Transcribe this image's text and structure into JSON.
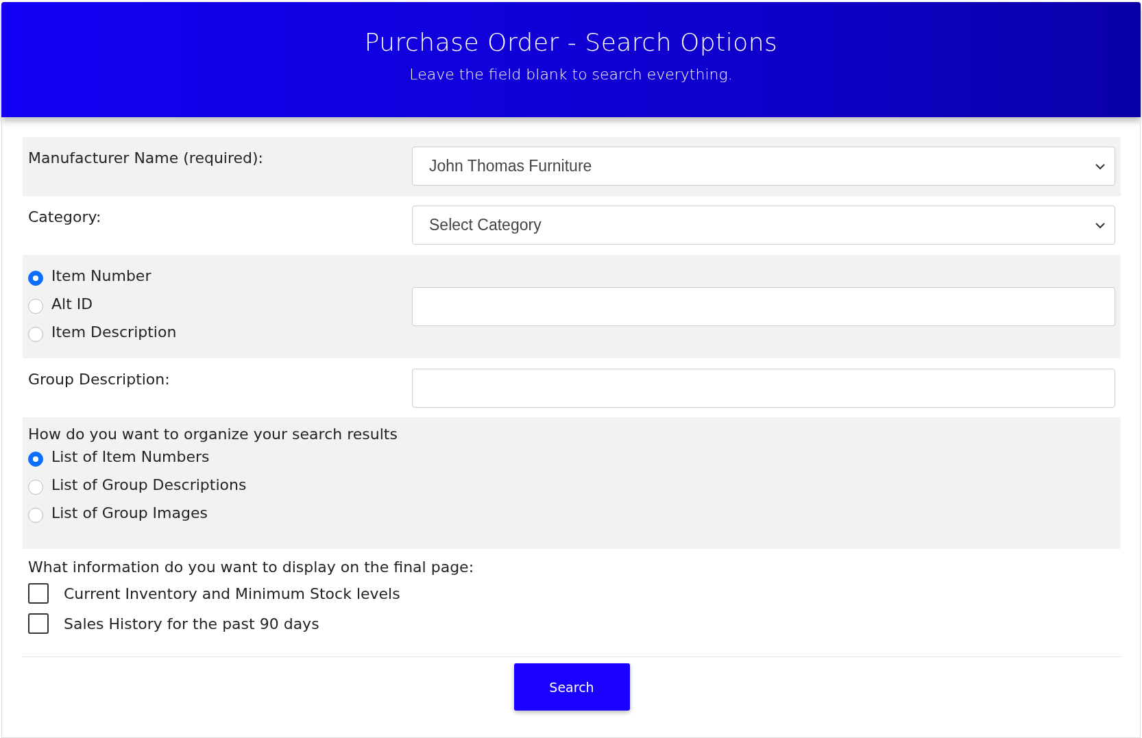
{
  "header": {
    "title": "Purchase Order - Search Options",
    "subtitle": "Leave the field blank to search everything."
  },
  "rows": [
    {
      "kind": "select",
      "label": "Manufacturer Name (required):",
      "value": "John Thomas Furniture"
    },
    {
      "kind": "select",
      "label": "Category:",
      "value": "Select Category"
    },
    {
      "kind": "radio-input",
      "options": [
        {
          "label": "Item Number",
          "selected": true
        },
        {
          "label": "Alt ID",
          "selected": false
        },
        {
          "label": "Item Description",
          "selected": false
        }
      ]
    },
    {
      "kind": "text",
      "label": "Group Description:"
    },
    {
      "kind": "radio-group",
      "label": "How do you want to organize your search results",
      "options": [
        {
          "label": "List of Item Numbers",
          "selected": true
        },
        {
          "label": "List of Group Descriptions",
          "selected": false
        },
        {
          "label": "List of Group Images",
          "selected": false
        }
      ]
    },
    {
      "kind": "checkbox-group",
      "label": "What information do you want to display on the final page:",
      "options": [
        {
          "label": "Current Inventory and Minimum Stock levels",
          "checked": false
        },
        {
          "label": "Sales History for the past 90 days",
          "checked": false
        }
      ]
    }
  ],
  "search_button": "Search"
}
